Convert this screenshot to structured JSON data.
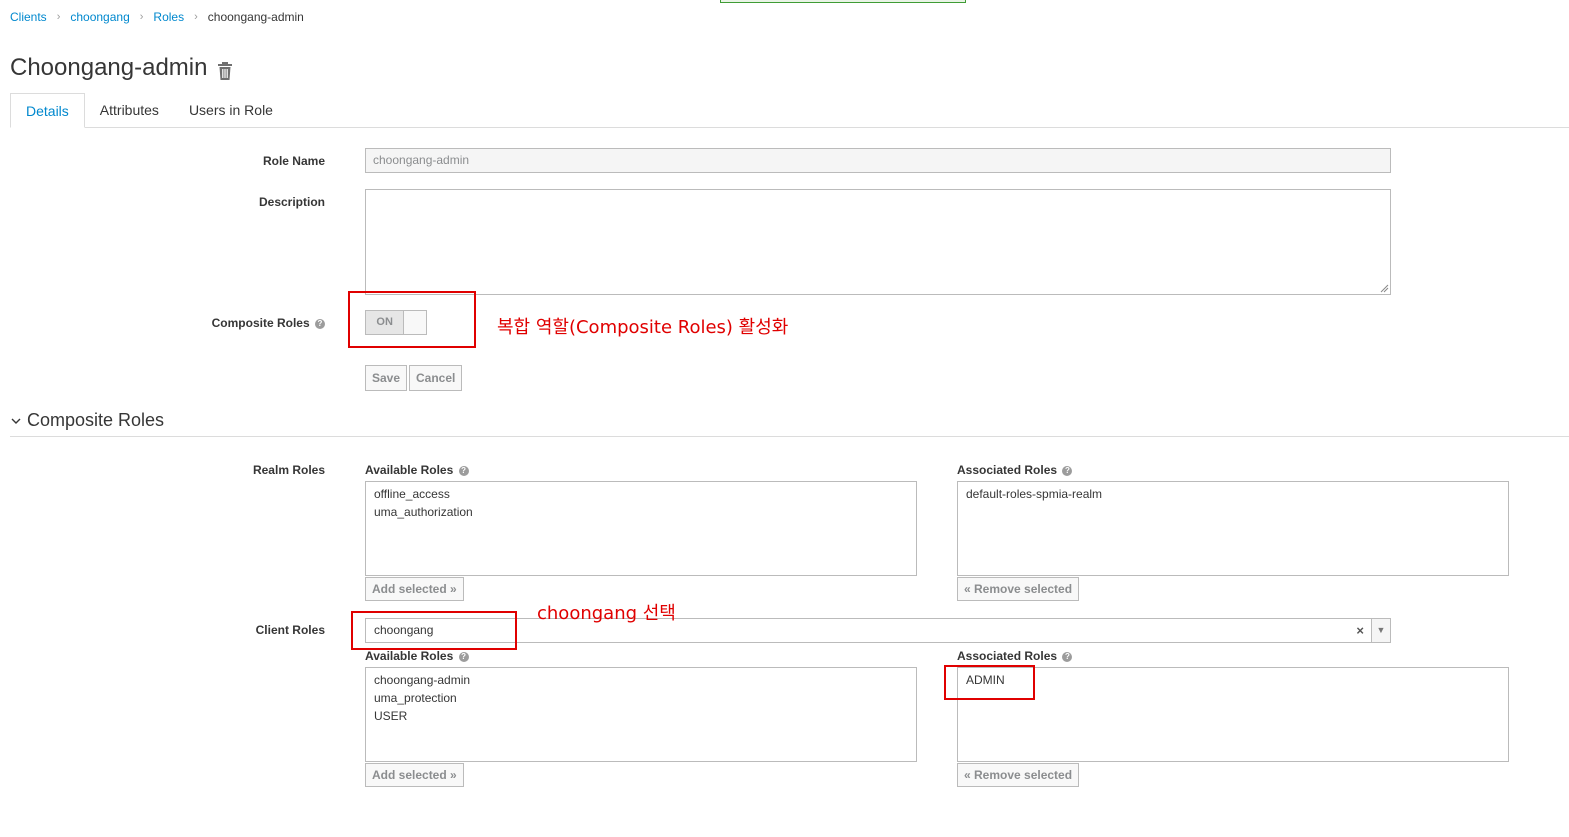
{
  "breadcrumb": {
    "items": [
      "Clients",
      "choongang",
      "Roles"
    ],
    "current": "choongang-admin",
    "separator": "›"
  },
  "page": {
    "title": "Choongang-admin"
  },
  "tabs": [
    "Details",
    "Attributes",
    "Users in Role"
  ],
  "form": {
    "role_name_label": "Role Name",
    "role_name_value": "choongang-admin",
    "description_label": "Description",
    "description_value": "",
    "composite_label": "Composite Roles",
    "composite_toggle": "ON",
    "save_label": "Save",
    "cancel_label": "Cancel"
  },
  "composite_section": {
    "title": "Composite Roles",
    "realm_label": "Realm Roles",
    "client_label": "Client Roles",
    "available_label": "Available Roles",
    "associated_label": "Associated Roles",
    "add_selected": "Add selected »",
    "remove_selected": "« Remove selected",
    "realm_available": [
      "offline_access",
      "uma_authorization"
    ],
    "realm_associated": [
      "default-roles-spmia-realm"
    ],
    "client_select_value": "choongang",
    "client_available": [
      "choongang-admin",
      "uma_protection",
      "USER"
    ],
    "client_associated": [
      "ADMIN"
    ]
  },
  "annotations": {
    "composite_note": "복합 역할(Composite Roles) 활성화",
    "client_note": "choongang 선택"
  },
  "colors": {
    "link": "#0088ce",
    "annotation": "#e00000",
    "border": "#bbbbbb"
  },
  "icons": {
    "delete": "trash-icon",
    "help": "question-circle-icon",
    "section_toggle": "chevron-down-icon",
    "select_clear": "close-icon",
    "select_arrow": "caret-down-icon"
  }
}
